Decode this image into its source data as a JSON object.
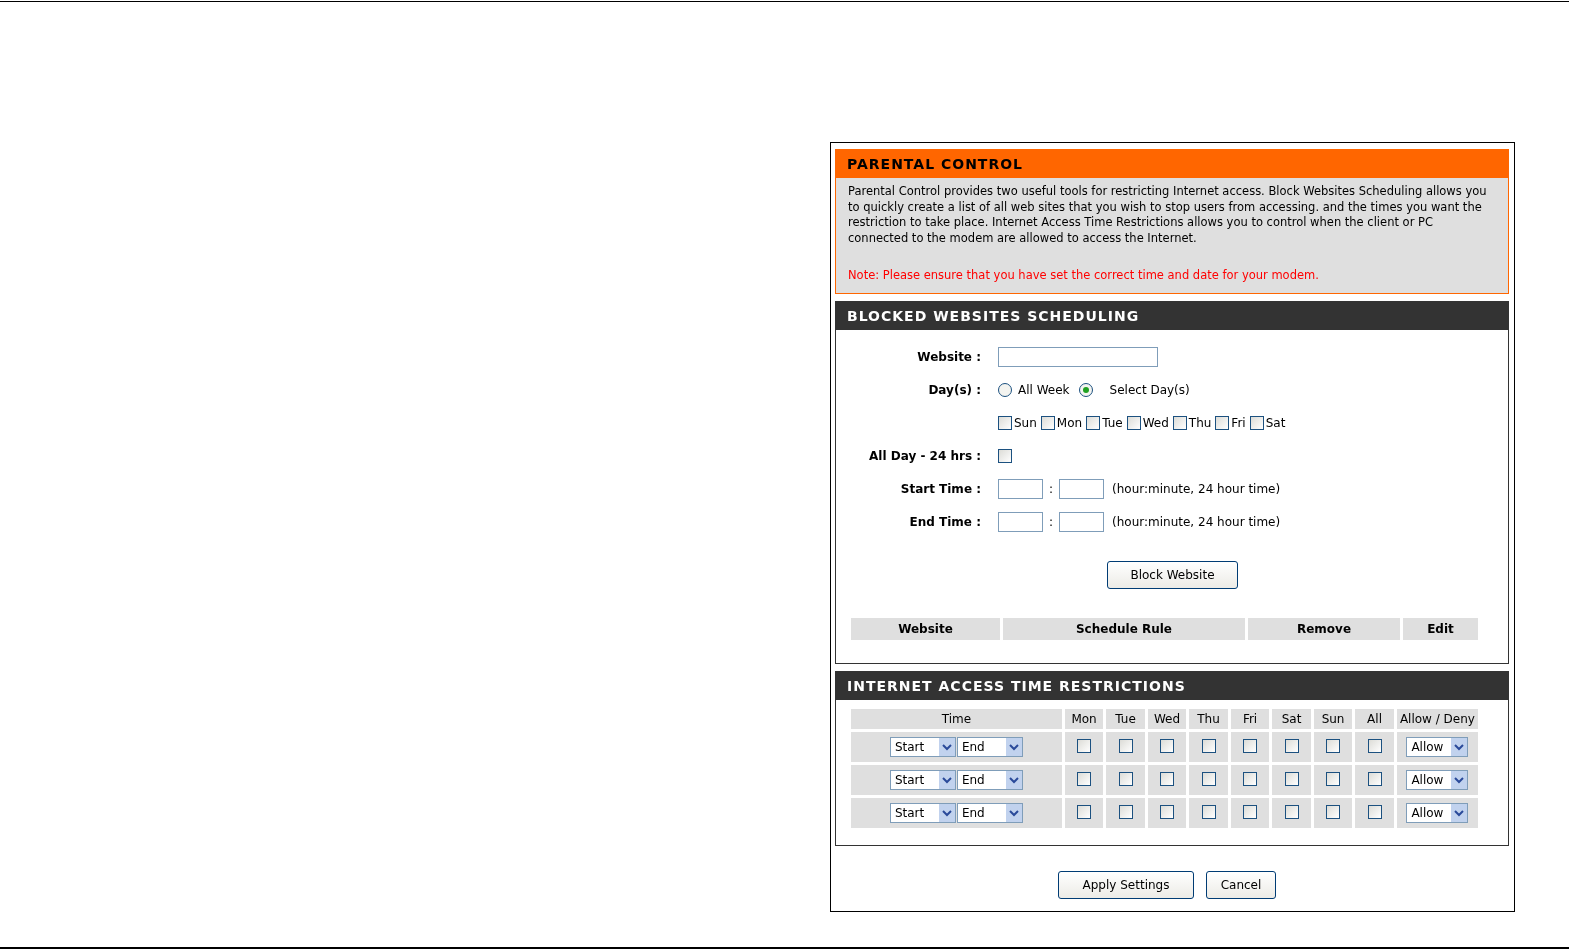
{
  "parental_control": {
    "title": "PARENTAL CONTROL",
    "description": "Parental Control provides two useful tools for restricting Internet access. Block Websites Scheduling allows you to quickly create a list of all web sites that you wish to stop users from accessing. and the times you want the restriction to take place. Internet Access Time Restrictions allows you to control when the client or PC connected to the modem are allowed to access the Internet.",
    "note": "Note: Please ensure that you have set the correct time and date for your modem."
  },
  "blocked_websites": {
    "title": "BLOCKED WEBSITES SCHEDULING",
    "website": {
      "label": "Website :"
    },
    "days": {
      "label": "Day(s) :",
      "options": [
        {
          "label": "All Week",
          "selected": false
        },
        {
          "label": "Select Day(s)",
          "selected": true
        }
      ]
    },
    "day_checkboxes": [
      {
        "label": "Sun",
        "checked": false
      },
      {
        "label": "Mon",
        "checked": false
      },
      {
        "label": "Tue",
        "checked": false
      },
      {
        "label": "Wed",
        "checked": false
      },
      {
        "label": "Thu",
        "checked": false
      },
      {
        "label": "Fri",
        "checked": false
      },
      {
        "label": "Sat",
        "checked": false
      }
    ],
    "all_day": {
      "label": "All Day - 24 hrs :",
      "checked": false
    },
    "start_time": {
      "label": "Start Time :",
      "separator": ":",
      "hint": "(hour:minute, 24 hour time)"
    },
    "end_time": {
      "label": "End Time :",
      "separator": ":",
      "hint": "(hour:minute, 24 hour time)"
    },
    "button": "Block Website",
    "table": {
      "columns": [
        "Website",
        "Schedule Rule",
        "Remove",
        "Edit"
      ]
    }
  },
  "time_restrictions": {
    "title": "INTERNET ACCESS TIME RESTRICTIONS",
    "columns": [
      "Time",
      "Mon",
      "Tue",
      "Wed",
      "Thu",
      "Fri",
      "Sat",
      "Sun",
      "All",
      "Allow / Deny"
    ],
    "rows": [
      {
        "start": "Start",
        "end": "End",
        "days": [
          false,
          false,
          false,
          false,
          false,
          false,
          false,
          false
        ],
        "action": "Allow"
      },
      {
        "start": "Start",
        "end": "End",
        "days": [
          false,
          false,
          false,
          false,
          false,
          false,
          false,
          false
        ],
        "action": "Allow"
      },
      {
        "start": "Start",
        "end": "End",
        "days": [
          false,
          false,
          false,
          false,
          false,
          false,
          false,
          false
        ],
        "action": "Allow"
      }
    ]
  },
  "buttons": [
    "Apply Settings",
    "Cancel"
  ]
}
